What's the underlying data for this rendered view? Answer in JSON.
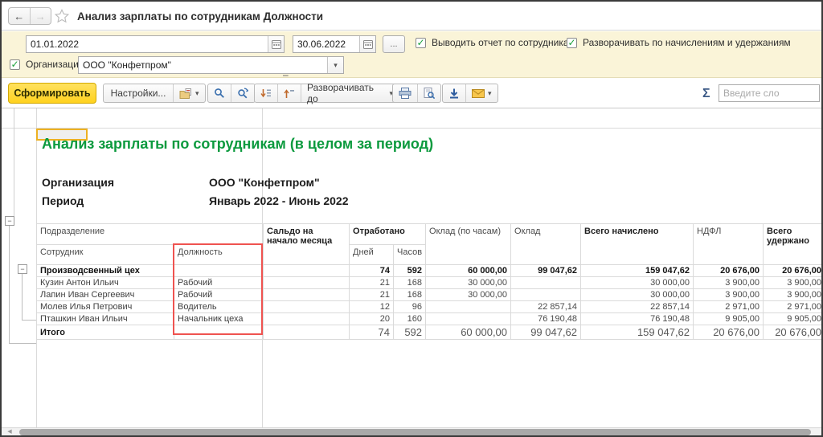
{
  "window": {
    "title": "Анализ зарплаты по сотрудникам Должности"
  },
  "filters": {
    "period_from": "01.01.2022",
    "period_to": "30.06.2022",
    "dash": "–",
    "more_button": "...",
    "checkbox_employees_label": "Выводить отчет по сотрудникам",
    "checkbox_expand_label": "Разворачивать по начислениям и удержаниям",
    "org_label": "Организация:",
    "org_value": "ООО \"Конфетпром\""
  },
  "toolbar": {
    "generate_label": "Сформировать",
    "settings_label": "Настройки...",
    "expand_to_label": "Разворачивать до",
    "sigma": "Σ",
    "search_placeholder": "Введите сло"
  },
  "report": {
    "title": "Анализ зарплаты по сотрудникам (в целом за период)",
    "org_label": "Организация",
    "org_value": "ООО \"Конфетпром\"",
    "period_label": "Период",
    "period_value": "Январь 2022 - Июнь 2022",
    "collapse_glyph": "−"
  },
  "table": {
    "header": {
      "department": "Подразделение",
      "employee": "Сотрудник",
      "position": "Должность",
      "balance": "Сальдо на начало месяца",
      "worked": "Отработано",
      "days": "Дней",
      "hours": "Часов",
      "salary_hourly": "Оклад (по часам)",
      "salary": "Оклад",
      "accrued": "Всего начислено",
      "ndfl": "НДФЛ",
      "withheld": "Всего удержано"
    },
    "rows": [
      {
        "name": "Производсвенный цех",
        "position": "",
        "balance": "",
        "days": "74",
        "hours": "592",
        "salary_hourly": "60 000,00",
        "salary": "99 047,62",
        "accrued": "159 047,62",
        "ndfl": "20 676,00",
        "withheld": "20 676,00"
      },
      {
        "name": "Кузин Антон Ильич",
        "position": "Рабочий",
        "balance": "",
        "days": "21",
        "hours": "168",
        "salary_hourly": "30 000,00",
        "salary": "",
        "accrued": "30 000,00",
        "ndfl": "3 900,00",
        "withheld": "3 900,00"
      },
      {
        "name": "Лапин Иван Сергеевич",
        "position": "Рабочий",
        "balance": "",
        "days": "21",
        "hours": "168",
        "salary_hourly": "30 000,00",
        "salary": "",
        "accrued": "30 000,00",
        "ndfl": "3 900,00",
        "withheld": "3 900,00"
      },
      {
        "name": "Молев Илья Петрович",
        "position": "Водитель",
        "balance": "",
        "days": "12",
        "hours": "96",
        "salary_hourly": "",
        "salary": "22 857,14",
        "accrued": "22 857,14",
        "ndfl": "2 971,00",
        "withheld": "2 971,00"
      },
      {
        "name": "Пташкин Иван Ильич",
        "position": "Начальник цеха",
        "balance": "",
        "days": "20",
        "hours": "160",
        "salary_hourly": "",
        "salary": "76 190,48",
        "accrued": "76 190,48",
        "ndfl": "9 905,00",
        "withheld": "9 905,00"
      },
      {
        "name": "Итого",
        "position": "",
        "balance": "",
        "days": "74",
        "hours": "592",
        "salary_hourly": "60 000,00",
        "salary": "99 047,62",
        "accrued": "159 047,62",
        "ndfl": "20 676,00",
        "withheld": "20 676,00"
      }
    ]
  },
  "colors": {
    "title_green": "#0c9a3e",
    "generate_yellow": "#ffd21f",
    "highlight_red": "#ef5350",
    "check_green": "#18a03a",
    "panel_yellow": "#faf4d8"
  }
}
